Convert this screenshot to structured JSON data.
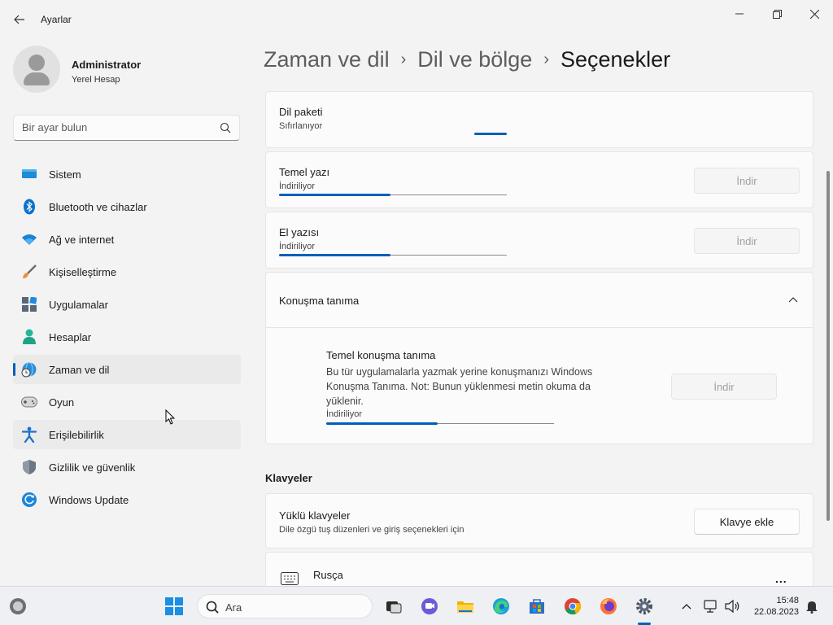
{
  "window": {
    "title": "Ayarlar",
    "back_icon": "back-arrow-icon",
    "controls": [
      "minimize-icon",
      "maximize-icon",
      "close-icon"
    ]
  },
  "profile": {
    "name": "Administrator",
    "subtitle": "Yerel Hesap"
  },
  "search": {
    "placeholder": "Bir ayar bulun"
  },
  "sidebar": {
    "items": [
      {
        "label": "Sistem",
        "icon": "monitor-icon"
      },
      {
        "label": "Bluetooth ve cihazlar",
        "icon": "bluetooth-icon"
      },
      {
        "label": "Ağ ve internet",
        "icon": "wifi-icon"
      },
      {
        "label": "Kişiselleştirme",
        "icon": "brush-icon"
      },
      {
        "label": "Uygulamalar",
        "icon": "apps-icon"
      },
      {
        "label": "Hesaplar",
        "icon": "person-icon"
      },
      {
        "label": "Zaman ve dil",
        "icon": "globe-clock-icon",
        "selected": true
      },
      {
        "label": "Oyun",
        "icon": "gamepad-icon"
      },
      {
        "label": "Erişilebilirlik",
        "icon": "accessibility-icon"
      },
      {
        "label": "Gizlilik ve güvenlik",
        "icon": "shield-icon"
      },
      {
        "label": "Windows Update",
        "icon": "update-icon"
      }
    ]
  },
  "breadcrumb": {
    "items": [
      "Zaman ve dil",
      "Dil ve bölge",
      "Seçenekler"
    ],
    "separator": "›"
  },
  "cards": {
    "language_pack": {
      "title": "Dil paketi",
      "status": "Sıfırlanıyor",
      "progress": "indeterminate"
    },
    "basic_typing": {
      "title": "Temel yazı",
      "status": "İndiriliyor",
      "progress": 0.49,
      "button": "İndir"
    },
    "handwriting": {
      "title": "El yazısı",
      "status": "İndiriliyor",
      "progress": 0.49,
      "button": "İndir"
    },
    "speech": {
      "title": "Konuşma tanıma",
      "expanded": true,
      "sub_title": "Temel konuşma tanıma",
      "description": "Bu tür uygulamalarla yazmak yerine konuşmanızı Windows Konuşma Tanıma. Not: Bunun yüklenmesi metin okuma da yüklenir.",
      "status": "İndiriliyor",
      "progress": 0.49,
      "button": "İndir"
    }
  },
  "keyboards": {
    "heading": "Klavyeler",
    "installed_title": "Yüklü klavyeler",
    "installed_sub": "Dile özgü tuş düzenleri ve giriş seçenekleri için",
    "add_button": "Klavye ekle",
    "items": [
      {
        "name": "Rusça",
        "more": "..."
      }
    ]
  },
  "taskbar": {
    "search_label": "Ara",
    "time": "15:48",
    "date": "22.08.2023"
  },
  "colors": {
    "accent": "#005fb8",
    "background": "#f3f3f3",
    "card": "#fbfbfb"
  }
}
